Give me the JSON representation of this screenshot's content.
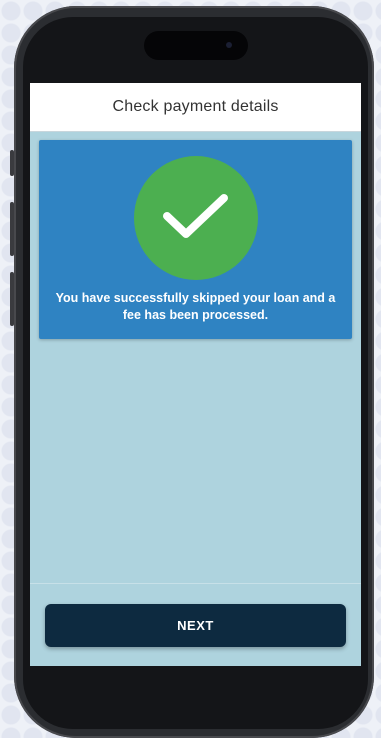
{
  "header": {
    "title": "Check payment details"
  },
  "success": {
    "icon": "checkmark-icon",
    "message": "You have successfully skipped your loan and a fee has been processed.",
    "card_color": "#2f83c2",
    "icon_color": "#4caf50"
  },
  "footer": {
    "next_label": "NEXT",
    "button_color": "#0d2a40"
  }
}
